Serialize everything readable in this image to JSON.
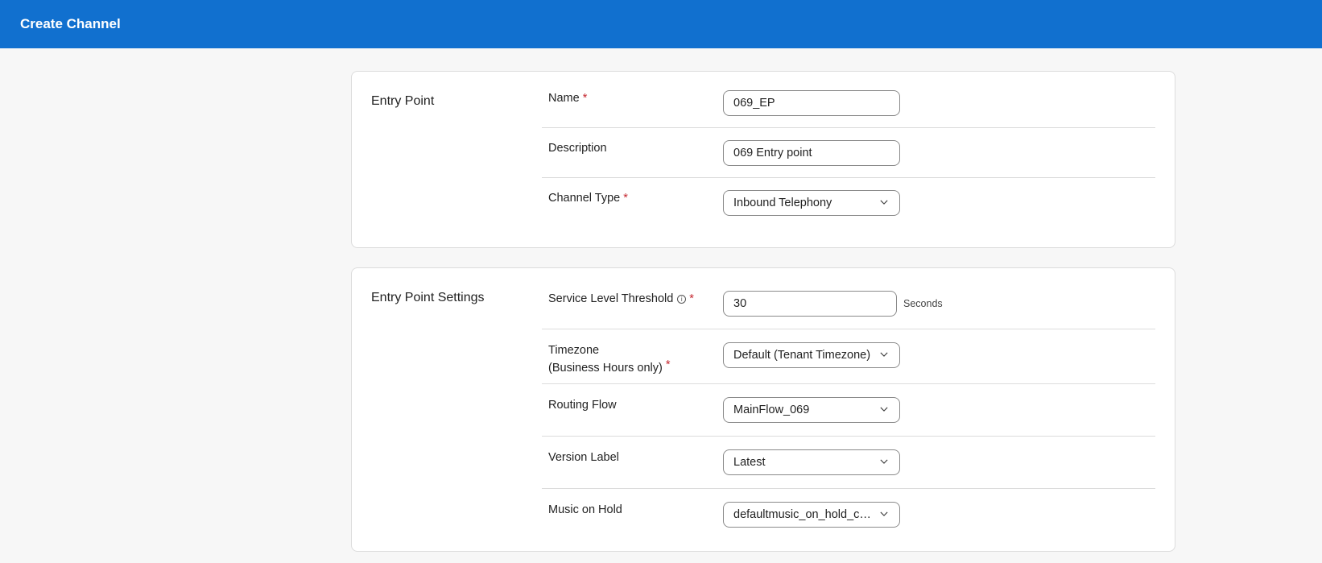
{
  "header": {
    "title": "Create Channel"
  },
  "entry_point": {
    "title": "Entry Point",
    "name": {
      "label": "Name",
      "required": "*",
      "value": "069_EP"
    },
    "description": {
      "label": "Description",
      "value": "069 Entry point"
    },
    "channel_type": {
      "label": "Channel Type",
      "required": "*",
      "value": "Inbound Telephony"
    }
  },
  "settings": {
    "title": "Entry Point Settings",
    "service_level": {
      "label": "Service Level Threshold",
      "required": "*",
      "value": "30",
      "suffix": "Seconds",
      "info_icon": "ⓘ"
    },
    "timezone": {
      "label_line1": "Timezone",
      "label_line2": "(Business Hours only)",
      "required": "*",
      "value": "Default (Tenant Timezone)"
    },
    "routing_flow": {
      "label": "Routing Flow",
      "value": "MainFlow_069"
    },
    "version_label": {
      "label": "Version Label",
      "value": "Latest"
    },
    "music_on_hold": {
      "label": "Music on Hold",
      "value": "defaultmusic_on_hold_cisco.wav"
    }
  },
  "colors": {
    "header_bg": "#1170cf",
    "required": "#c4262e"
  }
}
